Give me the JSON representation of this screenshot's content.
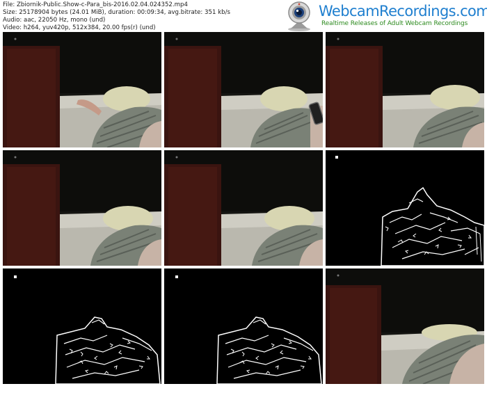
{
  "file_info": {
    "file_line": "File: Zbiornik-Public.Show-c-Para_bis-2016.02.04.024352.mp4",
    "size_line": "Size: 25178904 bytes (24.01 MiB), duration: 00:09:34, avg.bitrate: 351 kb/s",
    "audio_line": "Audio: aac, 22050 Hz, mono (und)",
    "video_line": "Video: h264, yuv420p, 512x384, 20.00 fps(r) (und)"
  },
  "brand": {
    "title": "WebcamRecordings.com",
    "tagline": "Realtime Releases of Adult Webcam Recordings",
    "title_color": "#1f7fcf",
    "tagline_color": "#2c8a1e",
    "logo_icon": "webcam-icon"
  },
  "thumbnails": [
    {
      "scene": "dark-room-bed-hand"
    },
    {
      "scene": "dark-room-bed-phone"
    },
    {
      "scene": "dark-room-bed"
    },
    {
      "scene": "dark-room-bed"
    },
    {
      "scene": "dark-room-bed"
    },
    {
      "scene": "edge-noise"
    },
    {
      "scene": "edge-noise"
    },
    {
      "scene": "edge-noise"
    },
    {
      "scene": "dark-room-bed-close"
    }
  ]
}
